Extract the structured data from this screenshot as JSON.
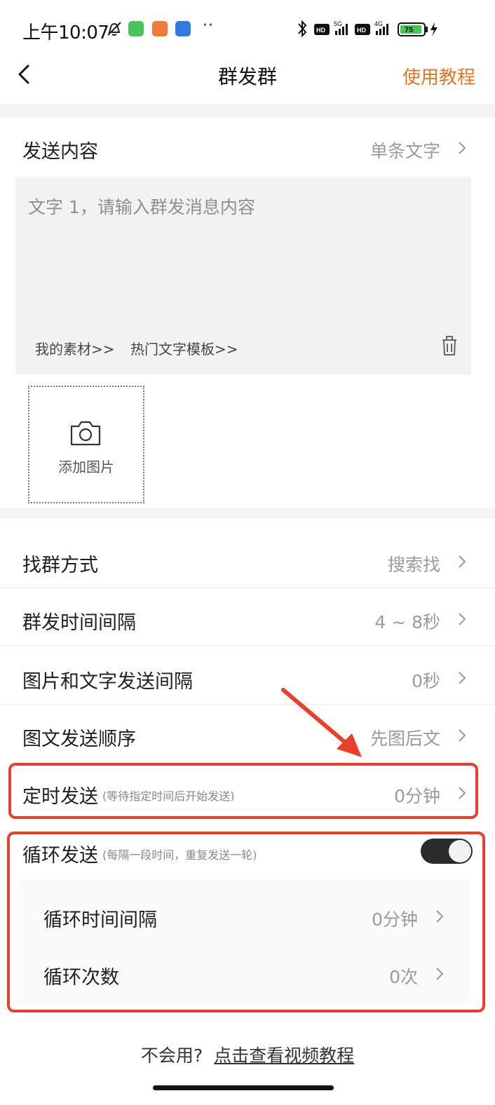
{
  "status_bar": {
    "time": "上午10:07",
    "more": "··",
    "network_5g": "5G",
    "network_4g": "4G",
    "hd": "HD",
    "battery": "75"
  },
  "nav": {
    "title": "群发群",
    "tutorial_label": "使用教程"
  },
  "content_section": {
    "label": "发送内容",
    "value": "单条文字",
    "placeholder": "文字 1，请输入群发消息内容",
    "material_link": "我的素材>>",
    "template_link": "热门文字模板>>",
    "add_image_label": "添加图片"
  },
  "settings": [
    {
      "label": "找群方式",
      "value": "搜索找"
    },
    {
      "label": "群发时间间隔",
      "value": "4 ~ 8秒"
    },
    {
      "label": "图片和文字发送间隔",
      "value": "0秒"
    },
    {
      "label": "图文发送顺序",
      "value": "先图后文"
    }
  ],
  "timed_send": {
    "label": "定时发送",
    "hint": "(等待指定时间后开始发送)",
    "value": "0分钟"
  },
  "loop_send": {
    "label": "循环发送",
    "hint": "(每隔一段时间，重复发送一轮)",
    "enabled": true,
    "interval_label": "循环时间间隔",
    "interval_value": "0分钟",
    "count_label": "循环次数",
    "count_value": "0次"
  },
  "footer": {
    "question": "不会用?",
    "link": "点击查看视频教程"
  },
  "colors": {
    "accent": "#e07628",
    "highlight": "#e8402b"
  }
}
